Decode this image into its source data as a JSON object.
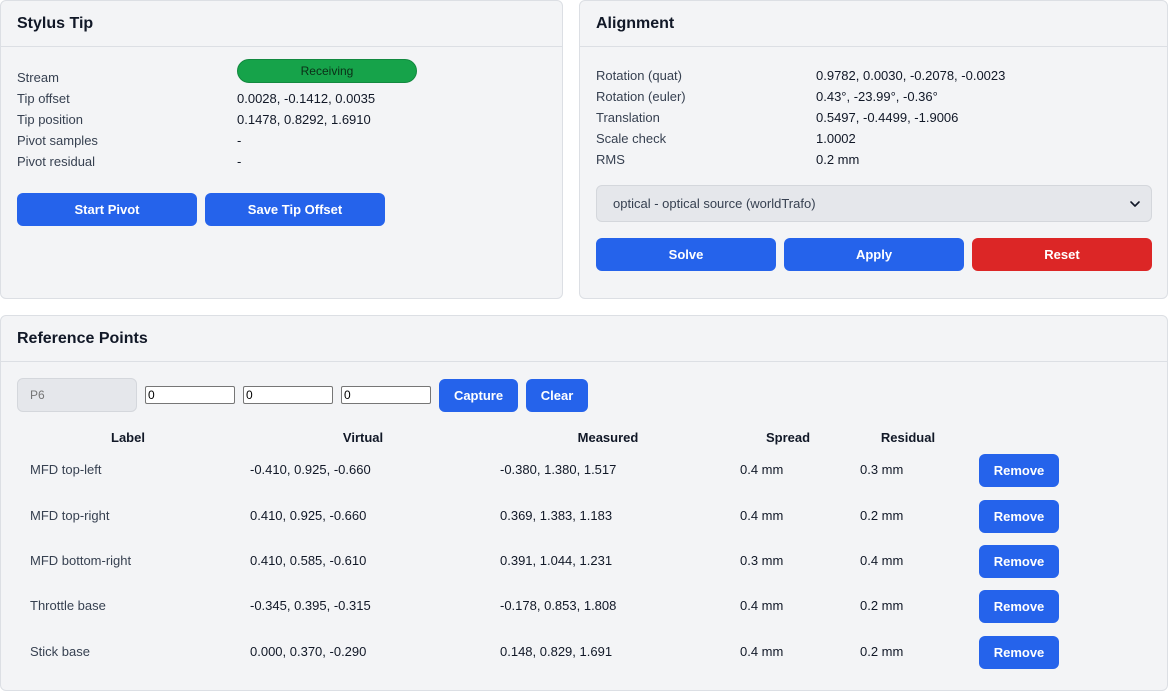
{
  "stylus": {
    "title": "Stylus Tip",
    "rows": [
      {
        "key": "Stream",
        "value": "Receiving"
      },
      {
        "key": "Tip offset",
        "value": "0.0028, -0.1412, 0.0035"
      },
      {
        "key": "Tip position",
        "value": "0.1478, 0.8292, 1.6910"
      },
      {
        "key": "Pivot samples",
        "value": "-"
      },
      {
        "key": "Pivot residual",
        "value": "-"
      }
    ],
    "status_color": "#16a34a",
    "start_pivot_label": "Start Pivot",
    "save_tip_label": "Save Tip Offset"
  },
  "alignment": {
    "title": "Alignment",
    "rows": [
      {
        "key": "Rotation (quat)",
        "value": "0.9782, 0.0030, -0.2078, -0.0023"
      },
      {
        "key": "Rotation (euler)",
        "value": "0.43°, -23.99°, -0.36°"
      },
      {
        "key": "Translation",
        "value": "0.5497, -0.4499, -1.9006"
      },
      {
        "key": "Scale check",
        "value": "1.0002"
      },
      {
        "key": "RMS",
        "value": "0.2 mm"
      }
    ],
    "source_select": "optical - optical source (worldTrafo)",
    "solve_label": "Solve",
    "apply_label": "Apply",
    "reset_label": "Reset"
  },
  "reference": {
    "title": "Reference Points",
    "name_placeholder": "P6",
    "x_value": "0",
    "y_value": "0",
    "z_value": "0",
    "capture_label": "Capture",
    "clear_label": "Clear",
    "headers": [
      "Label",
      "Virtual",
      "Measured",
      "Spread",
      "Residual"
    ],
    "remove_label": "Remove",
    "points": [
      {
        "label": "MFD top-left",
        "virtual": "-0.410, 0.925, -0.660",
        "measured": "-0.380, 1.380, 1.517",
        "spread": "0.4 mm",
        "residual": "0.3 mm"
      },
      {
        "label": "MFD top-right",
        "virtual": "0.410, 0.925, -0.660",
        "measured": "0.369, 1.383, 1.183",
        "spread": "0.4 mm",
        "residual": "0.2 mm"
      },
      {
        "label": "MFD bottom-right",
        "virtual": "0.410, 0.585, -0.610",
        "measured": "0.391, 1.044, 1.231",
        "spread": "0.3 mm",
        "residual": "0.4 mm"
      },
      {
        "label": "Throttle base",
        "virtual": "-0.345, 0.395, -0.315",
        "measured": "-0.178, 0.853, 1.808",
        "spread": "0.4 mm",
        "residual": "0.2 mm"
      },
      {
        "label": "Stick base",
        "virtual": "0.000, 0.370, -0.290",
        "measured": "0.148, 0.829, 1.691",
        "spread": "0.4 mm",
        "residual": "0.2 mm"
      }
    ]
  },
  "colors": {
    "accent": "#2563eb",
    "danger": "#dc2626",
    "success": "#16a34a"
  }
}
